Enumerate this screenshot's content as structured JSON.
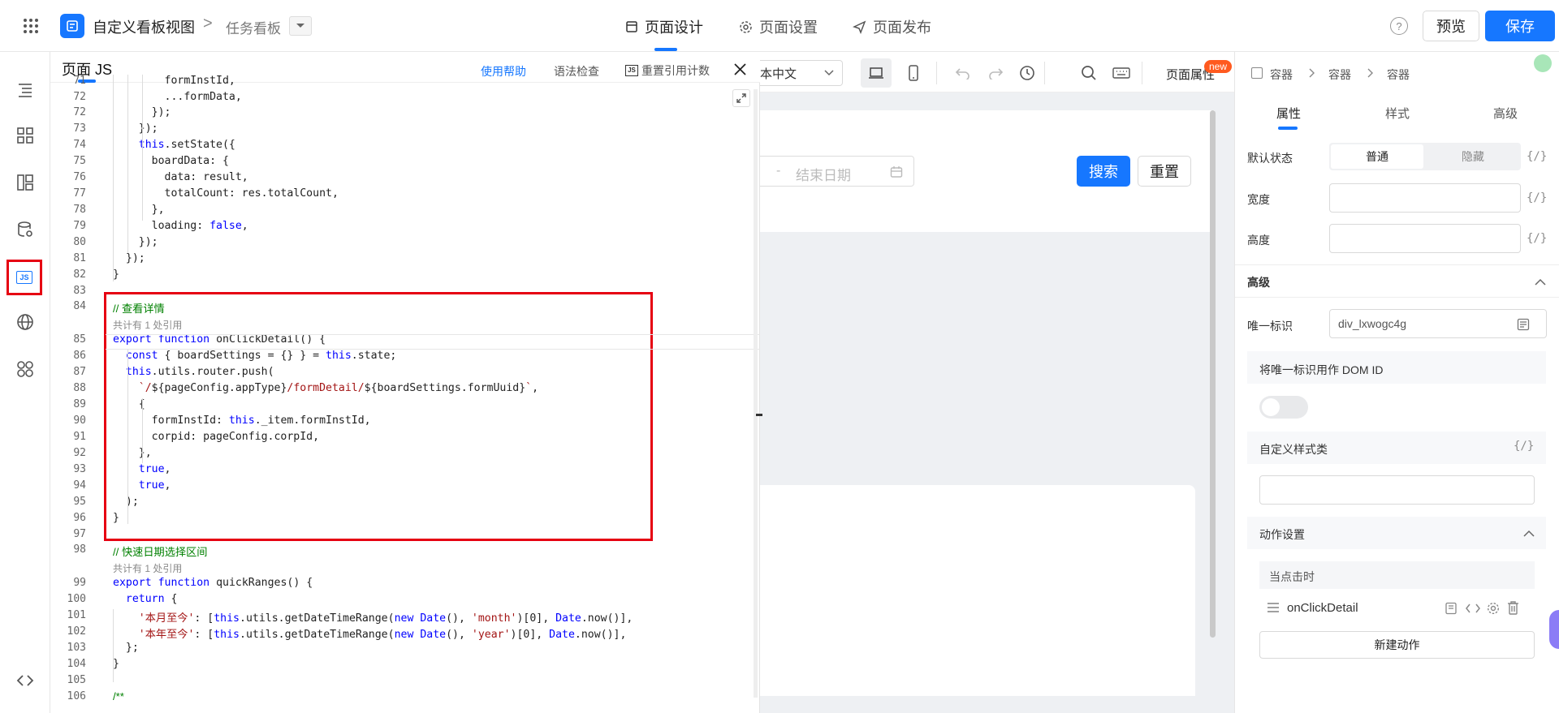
{
  "topbar": {
    "app_title": "自定义看板视图",
    "breadcrumb_sep": ">",
    "page_name": "任务看板",
    "tabs": [
      {
        "label": "页面设计",
        "active": true
      },
      {
        "label": "页面设置",
        "active": false
      },
      {
        "label": "页面发布",
        "active": false
      }
    ],
    "help_icon": "?",
    "preview_label": "预览",
    "save_label": "保存"
  },
  "rail": {
    "items": [
      "outline-icon",
      "components-icon",
      "layout-icon",
      "datasource-icon",
      "js-icon",
      "globe-icon",
      "plugins-icon"
    ],
    "bottom": "code-icon",
    "js_badge": "JS"
  },
  "code_panel": {
    "title": "页面 JS",
    "help_link": "使用帮助",
    "lint_label": "语法检查",
    "ref_label": "重置引用计数",
    "ref_badge": "JS",
    "ref_hint": "共计有 1 处引用",
    "lines": [
      {
        "n": "71",
        "html": "        formInstId,"
      },
      {
        "n": "72",
        "html": "        ...formData,"
      },
      {
        "n": "72",
        "html": "      });"
      },
      {
        "n": "73",
        "html": "    });"
      },
      {
        "n": "74",
        "html": "    <span class='kw'>this</span>.setState({"
      },
      {
        "n": "75",
        "html": "      boardData: {"
      },
      {
        "n": "76",
        "html": "        data: result,"
      },
      {
        "n": "77",
        "html": "        totalCount: res.totalCount,"
      },
      {
        "n": "78",
        "html": "      },"
      },
      {
        "n": "79",
        "html": "      loading: <span class='kw'>false</span>,"
      },
      {
        "n": "80",
        "html": "    });"
      },
      {
        "n": "81",
        "html": "  });"
      },
      {
        "n": "82",
        "html": "}"
      },
      {
        "n": "83",
        "html": ""
      },
      {
        "n": "84",
        "html": "<span class='cm'>// 查看详情</span>"
      },
      {
        "n": "85",
        "html": "<span class='kw'>export</span> <span class='kw'>function</span> onClickDetail() {"
      },
      {
        "n": "86",
        "html": "  <span class='kw'>const</span> { boardSettings = {} } = <span class='kw'>this</span>.state;"
      },
      {
        "n": "87",
        "html": "  <span class='kw'>this</span>.utils.router.push("
      },
      {
        "n": "88",
        "html": "    <span class='str'>`/</span>${pageConfig.appType}<span class='str'>/formDetail/</span>${boardSettings.formUuid}<span class='str'>`</span>,"
      },
      {
        "n": "89",
        "html": "    {"
      },
      {
        "n": "90",
        "html": "      formInstId: <span class='kw'>this</span>._item.formInstId,"
      },
      {
        "n": "91",
        "html": "      corpid: pageConfig.corpId,"
      },
      {
        "n": "92",
        "html": "    },"
      },
      {
        "n": "93",
        "html": "    <span class='kw'>true</span>,"
      },
      {
        "n": "94",
        "html": "    <span class='kw'>true</span>,"
      },
      {
        "n": "95",
        "html": "  );"
      },
      {
        "n": "96",
        "html": "}"
      },
      {
        "n": "97",
        "html": ""
      },
      {
        "n": "98",
        "html": "<span class='cm'>// 快速日期选择区间</span>"
      },
      {
        "n": "99",
        "html": "<span class='kw'>export</span> <span class='kw'>function</span> quickRanges() {"
      },
      {
        "n": "100",
        "html": "  <span class='kw'>return</span> {"
      },
      {
        "n": "101",
        "html": "    <span class='str'>'本月至今'</span>: [<span class='kw'>this</span>.utils.getDateTimeRange(<span class='kw'>new</span> <span class='kw'>Date</span>(), <span class='str'>'month'</span>)[0], <span class='kw'>Date</span>.now()],"
      },
      {
        "n": "102",
        "html": "    <span class='str'>'本年至今'</span>: [<span class='kw'>this</span>.utils.getDateTimeRange(<span class='kw'>new</span> <span class='kw'>Date</span>(), <span class='str'>'year'</span>)[0], <span class='kw'>Date</span>.now()],"
      },
      {
        "n": "103",
        "html": "  };"
      },
      {
        "n": "104",
        "html": "}"
      },
      {
        "n": "105",
        "html": ""
      },
      {
        "n": "106",
        "html": "<span class='cm'>/**</span>"
      }
    ]
  },
  "toolbar": {
    "lang_label": "本中文",
    "page_props": "页面属性",
    "new_badge": "new"
  },
  "canvas": {
    "end_date_placeholder": "结束日期",
    "date_sep": "-",
    "search_btn": "搜索",
    "reset_btn": "重置"
  },
  "right": {
    "breadcrumb": [
      "容器",
      "容器",
      "容器"
    ],
    "tabs": [
      "属性",
      "样式",
      "高级"
    ],
    "default_state_label": "默认状态",
    "state_options": [
      "普通",
      "隐藏"
    ],
    "width_label": "宽度",
    "height_label": "高度",
    "braces": "{/}",
    "advanced_title": "高级",
    "uid_label": "唯一标识",
    "uid_value": "div_lxwogc4g",
    "dom_id_label": "将唯一标识用作 DOM ID",
    "custom_class_label": "自定义样式类",
    "action_title": "动作设置",
    "on_click_label": "当点击时",
    "action_name": "onClickDetail",
    "new_action": "新建动作"
  }
}
